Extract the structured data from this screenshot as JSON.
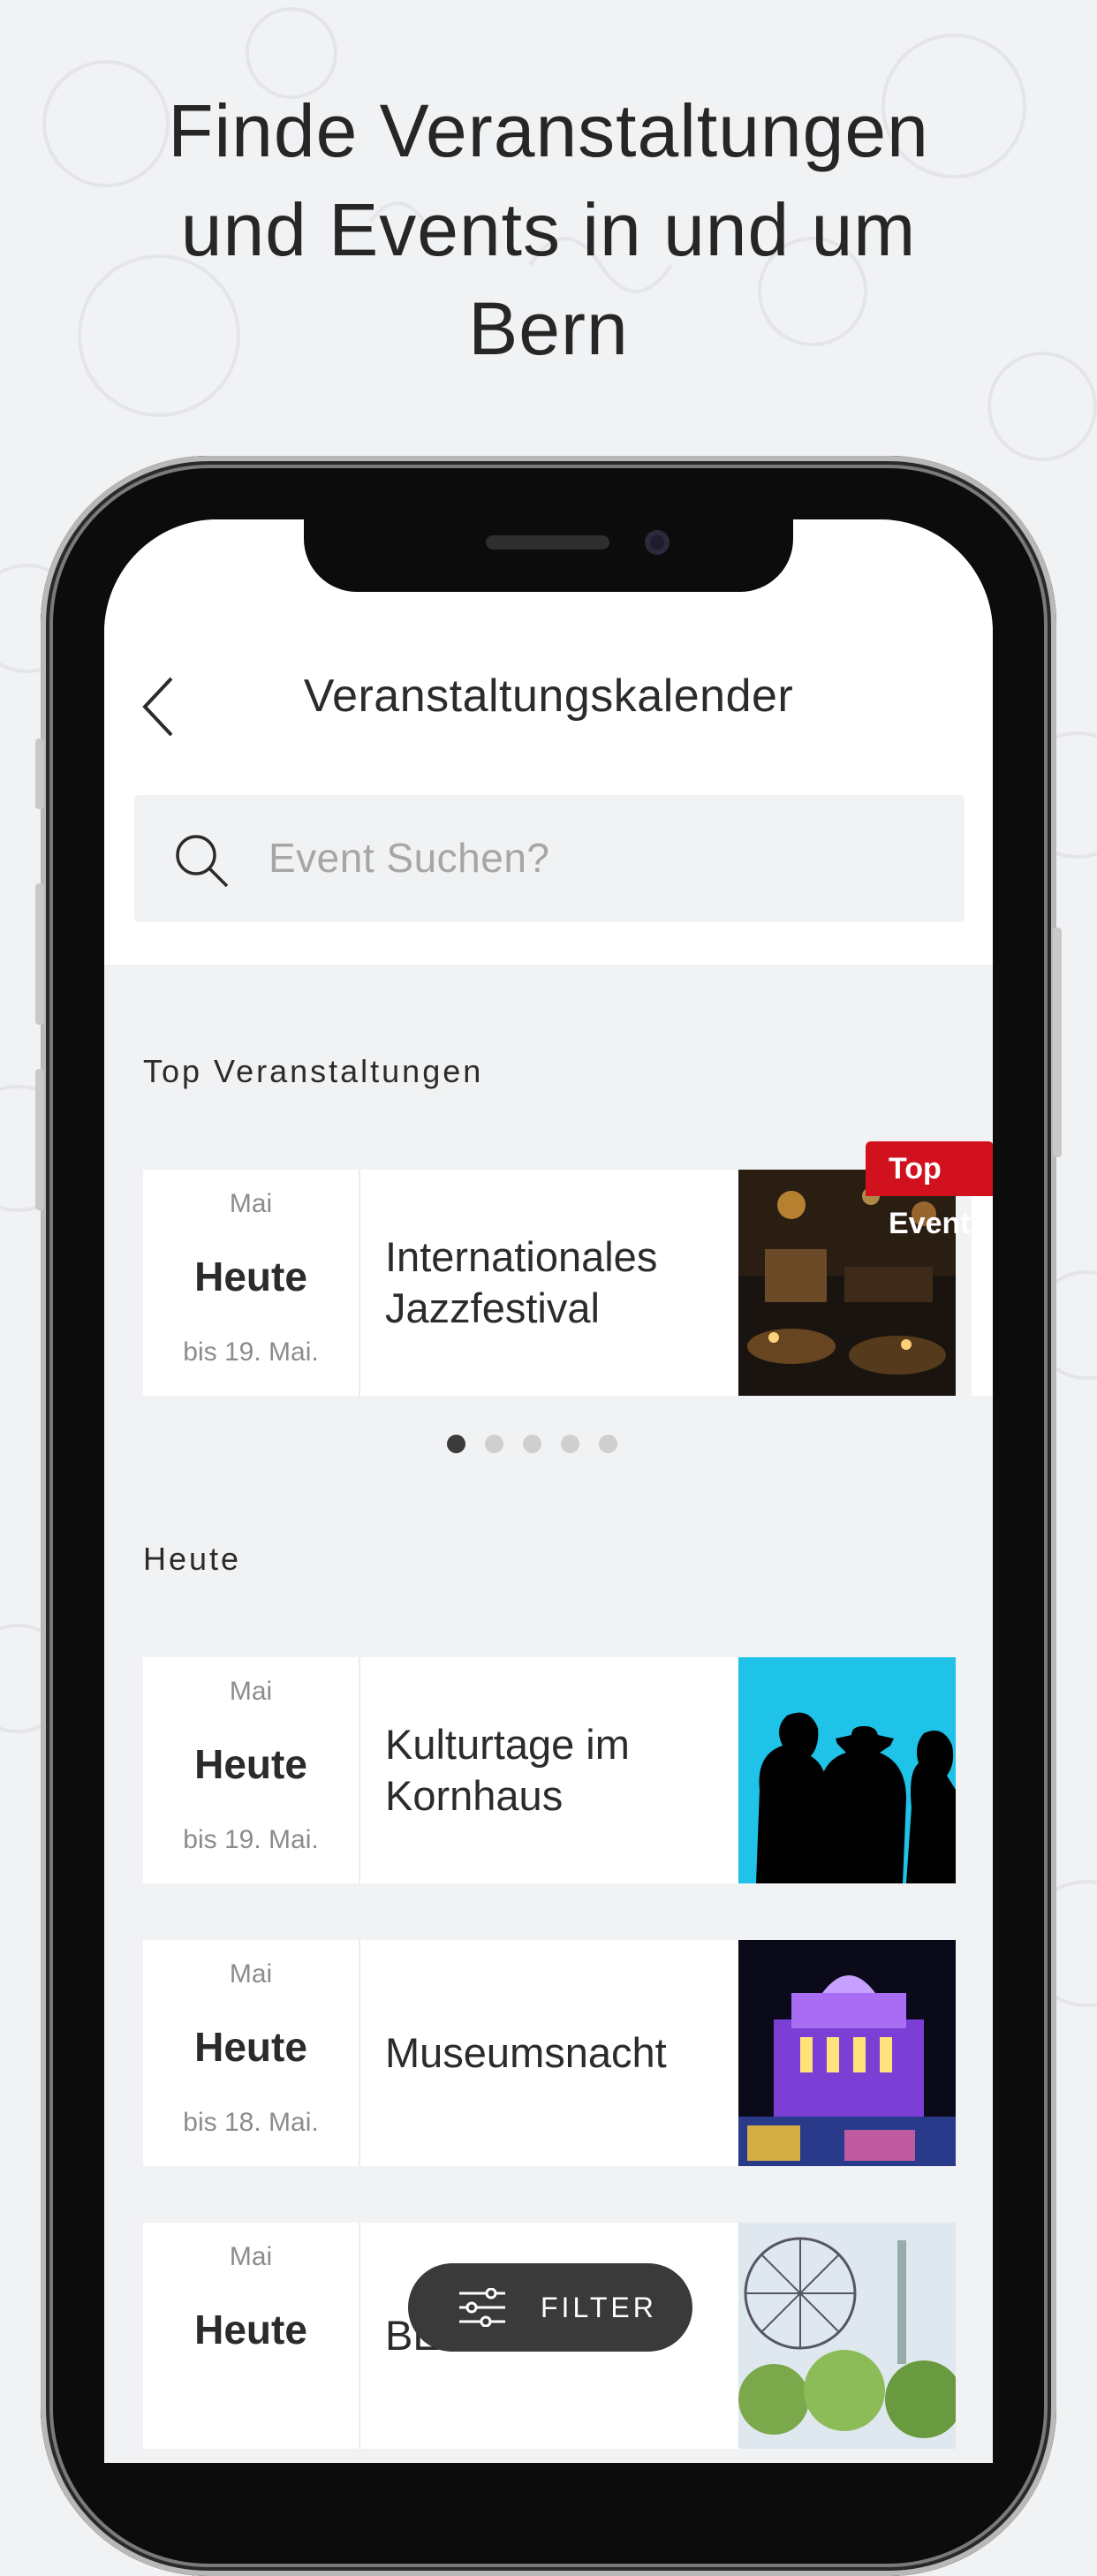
{
  "headline": {
    "lines": [
      "Finde Veranstaltungen",
      "und Events in und um",
      "Bern"
    ]
  },
  "nav": {
    "title": "Veranstaltungskalender",
    "back_icon": "chevron-left-icon"
  },
  "search": {
    "placeholder": "Event Suchen?",
    "icon": "search-icon"
  },
  "sections": {
    "top": "Top Veranstaltungen",
    "today": "Heute"
  },
  "top_event": {
    "badge": "Top Event",
    "month": "Mai",
    "day": "Heute",
    "until": "bis 19. Mai.",
    "title_line1": "Internationales",
    "title_line2": "Jazzfestival"
  },
  "carousel": {
    "pages": 5,
    "active": 0
  },
  "events": [
    {
      "month": "Mai",
      "day": "Heute",
      "until": "bis 19. Mai.",
      "title_line1": "Kulturtage im",
      "title_line2": "Kornhaus"
    },
    {
      "month": "Mai",
      "day": "Heute",
      "until": "bis 18. Mai.",
      "title_line1": "Museumsnacht",
      "title_line2": ""
    },
    {
      "month": "Mai",
      "day": "Heute",
      "until": "",
      "title_line1": "BEA 2019",
      "title_line2": ""
    }
  ],
  "filter": {
    "label": "FILTER",
    "icon": "sliders-icon"
  },
  "colors": {
    "accent_red": "#d1111d",
    "background": "#f1f2f4",
    "filter_bg": "#3a3a3a"
  }
}
